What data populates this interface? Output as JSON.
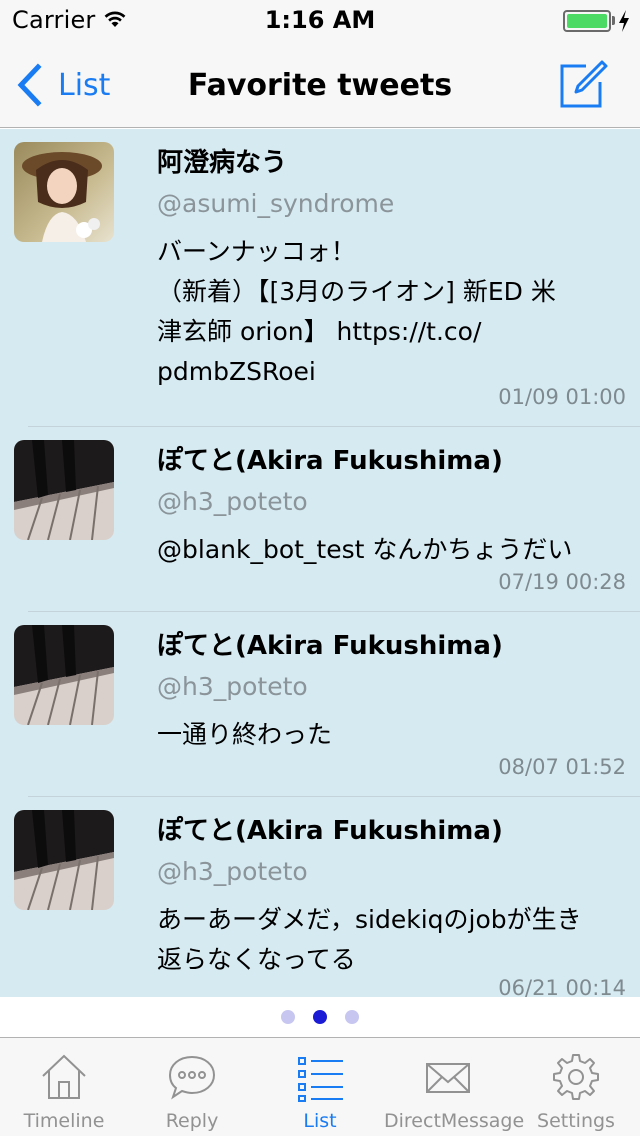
{
  "status_bar": {
    "carrier": "Carrier",
    "time": "1:16 AM",
    "battery_level": 1.0
  },
  "nav": {
    "back_label": "List",
    "title": "Favorite tweets",
    "back_icon": "chevron-left-icon",
    "compose_icon": "compose-icon"
  },
  "tweets": [
    {
      "name": "阿澄病なう",
      "handle": "@asumi_syndrome",
      "text": "バーンナッコォ！\n（新着）【[3月のライオン] 新ED 米津玄師 orion】 https://t.co/pdmbZSRoei",
      "time": "01/09 01:00",
      "avatar": "person-photo"
    },
    {
      "name": "ぽてと(Akira Fukushima)",
      "handle": "@h3_poteto",
      "text": "@blank_bot_test なんかちょうだい",
      "time": "07/19 00:28",
      "avatar": "piano-photo"
    },
    {
      "name": "ぽてと(Akira Fukushima)",
      "handle": "@h3_poteto",
      "text": "一通り終わった",
      "time": "08/07 01:52",
      "avatar": "piano-photo"
    },
    {
      "name": "ぽてと(Akira Fukushima)",
      "handle": "@h3_poteto",
      "text": "あーあーダメだ，sidekiqのjobが生き返らなくなってる",
      "time": "06/21 00:14",
      "avatar": "piano-photo"
    }
  ],
  "pager": {
    "count": 3,
    "active_index": 1
  },
  "tab_bar": {
    "tabs": [
      {
        "label": "Timeline",
        "icon": "home-icon"
      },
      {
        "label": "Reply",
        "icon": "speech-bubble-icon"
      },
      {
        "label": "List",
        "icon": "list-icon"
      },
      {
        "label": "DirectMessage",
        "icon": "envelope-icon"
      },
      {
        "label": "Settings",
        "icon": "gear-icon"
      }
    ],
    "active_index": 2
  },
  "colors": {
    "accent": "#1a7cf2",
    "tweet_background": "#d6eaf2",
    "pager_active": "#1b1bd6",
    "pager_inactive": "#c6c6f0",
    "battery": "#4cd964"
  }
}
